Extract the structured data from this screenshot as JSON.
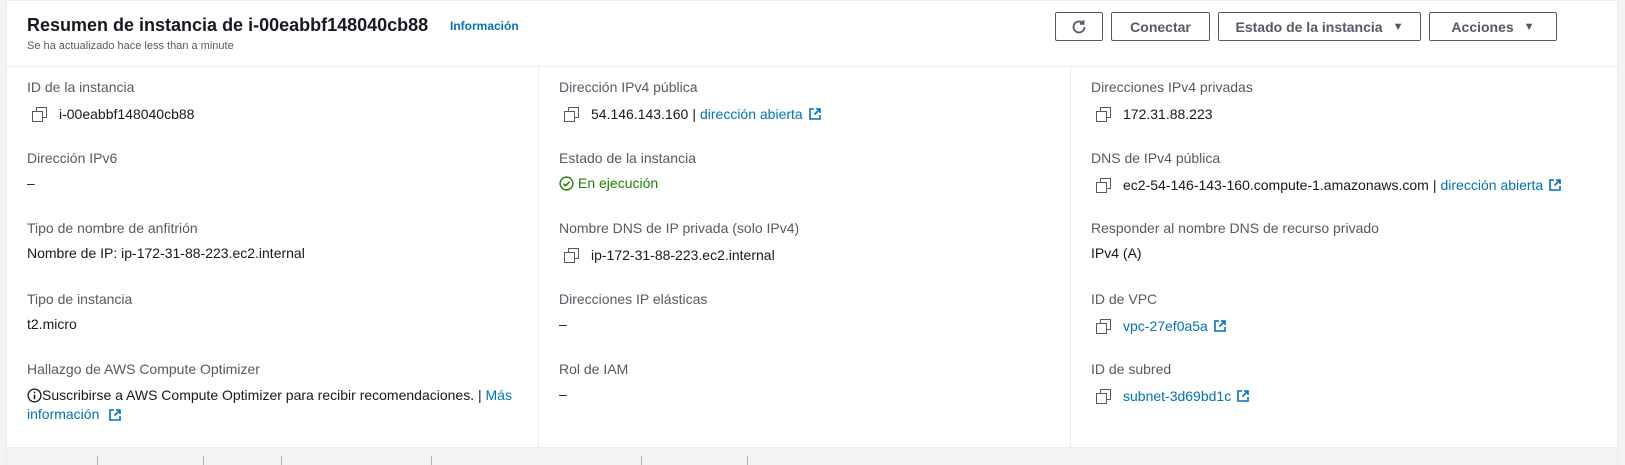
{
  "header": {
    "title": "Resumen de instancia de i-00eabbf148040cb88",
    "info_label": "Información",
    "subtitle": "Se ha actualizado hace less than a minute",
    "buttons": {
      "refresh_icon": "refresh-icon",
      "connect": "Conectar",
      "instance_state": "Estado de la instancia",
      "actions": "Acciones"
    }
  },
  "fields": {
    "instance_id": {
      "label": "ID de la instancia",
      "value": "i-00eabbf148040cb88"
    },
    "public_ipv4": {
      "label": "Dirección IPv4 pública",
      "value": "54.146.143.160",
      "sep": "|",
      "link": "dirección abierta"
    },
    "private_ipv4": {
      "label": "Direcciones IPv4 privadas",
      "value": "172.31.88.223"
    },
    "ipv6": {
      "label": "Dirección IPv6",
      "value": "–"
    },
    "instance_state": {
      "label": "Estado de la instancia",
      "value": "En ejecución"
    },
    "public_dns": {
      "label": "DNS de IPv4 pública",
      "value": "ec2-54-146-143-160.compute-1.amazonaws.com",
      "sep": "|",
      "link": "dirección abierta"
    },
    "hostname_type": {
      "label": "Tipo de nombre de anfitrión",
      "value": "Nombre de IP: ip-172-31-88-223.ec2.internal"
    },
    "private_dns": {
      "label": "Nombre DNS de IP privada (solo IPv4)",
      "value": "ip-172-31-88-223.ec2.internal"
    },
    "resource_dns": {
      "label": "Responder al nombre DNS de recurso privado",
      "value": "IPv4 (A)"
    },
    "instance_type": {
      "label": "Tipo de instancia",
      "value": "t2.micro"
    },
    "elastic_ips": {
      "label": "Direcciones IP elásticas",
      "value": "–"
    },
    "vpc_id": {
      "label": "ID de VPC",
      "value": "vpc-27ef0a5a"
    },
    "optimizer": {
      "label": "Hallazgo de AWS Compute Optimizer",
      "text": "Suscribirse a AWS Compute Optimizer para recibir recomendaciones. |",
      "link1": "Más",
      "link2": "información"
    },
    "iam_role": {
      "label": "Rol de IAM",
      "value": "–"
    },
    "subnet_id": {
      "label": "ID de subred",
      "value": "subnet-3d69bd1c"
    }
  },
  "colors": {
    "link": "#0073bb",
    "success": "#1d8102",
    "text": "#16191f",
    "muted": "#545b64"
  }
}
